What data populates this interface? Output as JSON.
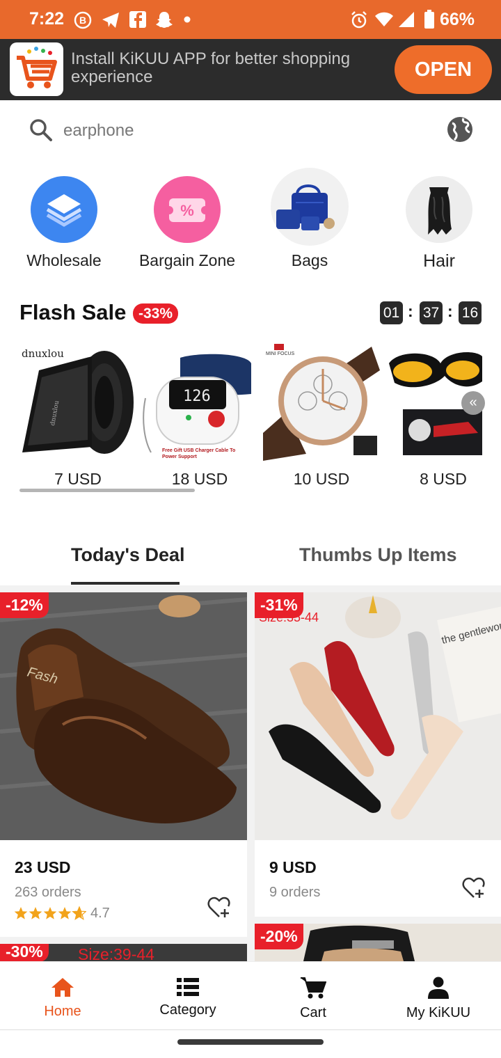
{
  "status_bar": {
    "time": "7:22",
    "battery": "66%",
    "color": "#e8692c"
  },
  "banner": {
    "text": "Install KiKUU APP for better shopping experience",
    "open_label": "OPEN",
    "accent": "#ee6d2a"
  },
  "search": {
    "text": "earphone",
    "icon": "search-icon",
    "globe_icon": "globe-icon"
  },
  "categories": [
    {
      "label": "Wholesale",
      "icon": "layers-icon"
    },
    {
      "label": "Bargain Zone",
      "icon": "coupon-icon"
    },
    {
      "label": "Bags",
      "icon": "bag-image"
    },
    {
      "label": "Hair",
      "icon": "hair-image"
    }
  ],
  "flash_sale": {
    "title": "Flash Sale",
    "badge": "-33%",
    "timer": {
      "hours": "01",
      "minutes": "37",
      "seconds": "16"
    },
    "items": [
      {
        "name": "belt",
        "brand": "dnuxlou",
        "price": "7 USD"
      },
      {
        "name": "blood-pressure-monitor",
        "caption": "Free Gift USB Charger Cable To Power Support",
        "price": "18 USD"
      },
      {
        "name": "watch",
        "brand": "MINI FOCUS",
        "price": "10 USD"
      },
      {
        "name": "night-vision-glasses",
        "price": "8 USD"
      }
    ]
  },
  "tabs": [
    {
      "label": "Today's Deal",
      "active": true
    },
    {
      "label": "Thumbs Up Items",
      "active": false
    }
  ],
  "products": [
    {
      "discount": "-12%",
      "price": "23 USD",
      "orders": "263 orders",
      "rating": "4.7",
      "stars": 4.7,
      "image_text": "Fash"
    },
    {
      "discount": "-31%",
      "price": "9 USD",
      "orders": "9 orders",
      "image_text": "Size:35-44",
      "magazine_text": "the gentlewoman"
    },
    {
      "discount": "-30%",
      "image_text": "Size:39-44"
    },
    {
      "discount": "-20%"
    }
  ],
  "bottom_nav": [
    {
      "label": "Home",
      "icon": "home-icon",
      "active": true
    },
    {
      "label": "Category",
      "icon": "list-icon",
      "active": false
    },
    {
      "label": "Cart",
      "icon": "cart-icon",
      "active": false
    },
    {
      "label": "My KiKUU",
      "icon": "person-icon",
      "active": false
    }
  ]
}
